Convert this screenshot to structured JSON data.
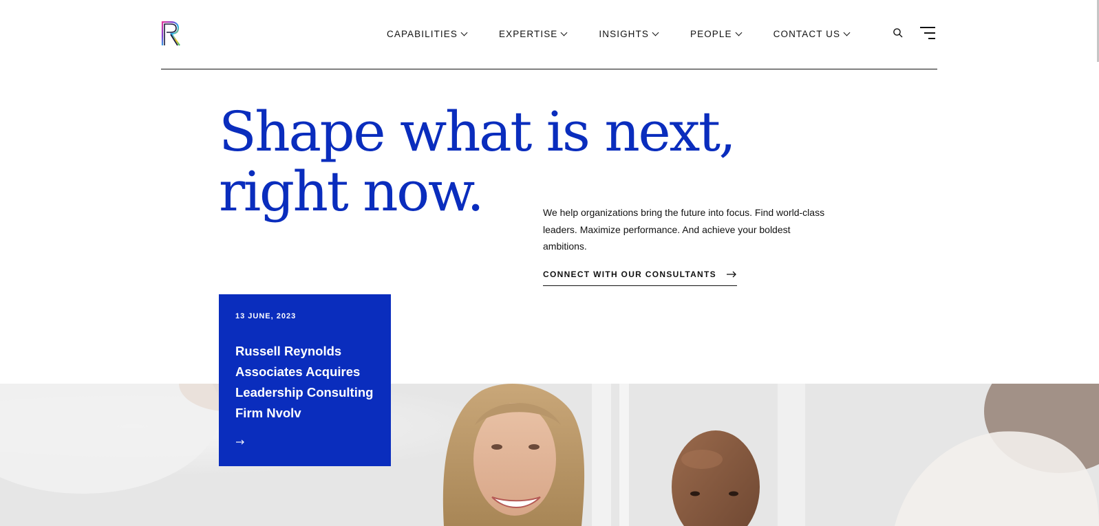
{
  "header": {
    "nav": [
      {
        "label": "CAPABILITIES"
      },
      {
        "label": "EXPERTISE"
      },
      {
        "label": "INSIGHTS"
      },
      {
        "label": "PEOPLE"
      },
      {
        "label": "CONTACT US"
      }
    ]
  },
  "hero": {
    "title_line1": "Shape what is next,",
    "title_line2": "right now.",
    "description": "We help organizations bring the future into focus. Find world-class leaders. Maximize performance. And achieve your boldest ambitions.",
    "cta_label": "CONNECT WITH OUR CONSULTANTS"
  },
  "news_card": {
    "date": "13 JUNE, 2023",
    "title": "Russell Reynolds Associates Acquires Leadership Consulting Firm Nvolv"
  },
  "colors": {
    "brand_blue": "#0a2dbd",
    "text": "#111111",
    "background": "#ffffff"
  },
  "icons": {
    "logo": "rra-logo-icon",
    "search": "search-icon",
    "menu": "menu-icon",
    "chevron": "chevron-down-icon",
    "arrow": "arrow-right-icon"
  }
}
